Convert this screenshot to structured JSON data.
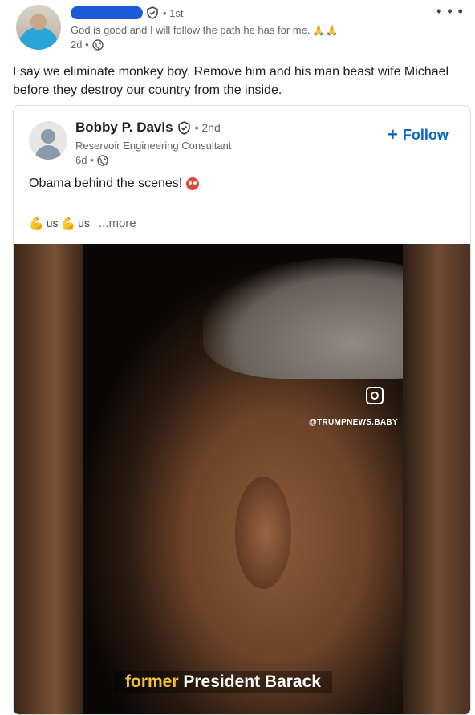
{
  "outer_post": {
    "connection_degree": "• 1st",
    "headline": "God is good and I will follow the path he has for me.",
    "headline_emoji": "🙏🙏",
    "time": "2d •",
    "commentary": "I say we eliminate monkey boy. Remove him and his man beast wife Michael before they destroy our country from the inside."
  },
  "shared_post": {
    "author_name": "Bobby P. Davis",
    "connection_degree": "• 2nd",
    "headline": "Reservoir Engineering Consultant",
    "time": "6d •",
    "follow_label": "Follow",
    "text": "Obama behind the scenes!",
    "tag_1": "us",
    "tag_2": "us",
    "more_label": "...more"
  },
  "video": {
    "watermark": "@TRUMPNEWS.BABY",
    "caption_accent": "former",
    "caption_rest": "President Barack"
  },
  "icons": {
    "verified": "shield-check-icon",
    "globe": "globe-icon",
    "more": "more-dots-icon",
    "follow": "plus-icon",
    "angry": "angry-face-icon",
    "flex": "flexed-biceps-icon",
    "instagram": "instagram-icon"
  },
  "colors": {
    "follow_blue": "#0a66c2",
    "caption_accent": "#f4c430"
  }
}
